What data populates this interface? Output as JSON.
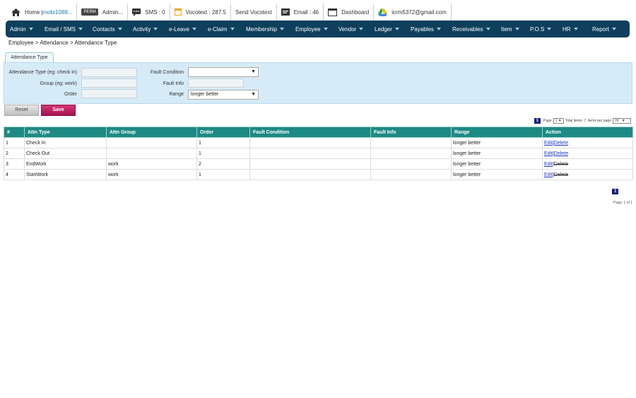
{
  "topbar": {
    "home_label": "Home | ",
    "home_user": "mobi1088...",
    "perm_badge": "PERM",
    "admin_label": "Admin...",
    "sms_label": "SMS : 0",
    "vocotext_label": "Vocotext : 287.5",
    "send_vocotext_label": "Send Vocotext",
    "email_label": "Email : 46",
    "dashboard_label": "Dashboard",
    "account_email": "icrm5372@gmail.com"
  },
  "nav": [
    "Admin",
    "Email / SMS",
    "Contacts",
    "Activity",
    "e-Leave",
    "e-Claim",
    "Membership",
    "Employee",
    "Vendor",
    "Ledger",
    "Payables",
    "Receivables",
    "Item",
    "P.O.S",
    "HR",
    "Report"
  ],
  "breadcrumb": "Employee > Attendance > Attendance Type",
  "tab_label": "Attendance Type",
  "form": {
    "attn_type_label": "Attendance Type (eg: check in)",
    "group_label": "Group (eg: work)",
    "order_label": "Order",
    "fault_condition_label": "Fault Condition",
    "fault_info_label": "Fault Info",
    "range_label": "Range",
    "range_value": "longer better",
    "fault_condition_value": "",
    "reset_label": "Reset",
    "save_label": "Save"
  },
  "pager": {
    "current_page": "1",
    "page_label": "Page",
    "page_select": "1",
    "total_items_text": "Total items: 7, items per page",
    "per_page": "20",
    "page_of_text": "Page: 1 of 1"
  },
  "table": {
    "headers": [
      "#",
      "Attn Type",
      "Attn Group",
      "Order",
      "Fault Condition",
      "Fault Info",
      "Range",
      "Action"
    ],
    "rows": [
      {
        "num": "1",
        "type": "Check In",
        "group": "",
        "order": "1",
        "fault_condition": "",
        "fault_info": "",
        "range": "longer better",
        "edit": "Edit",
        "delete": "Delete",
        "delete_enabled": true
      },
      {
        "num": "2",
        "type": "Check Out",
        "group": "",
        "order": "1",
        "fault_condition": "",
        "fault_info": "",
        "range": "longer better",
        "edit": "Edit",
        "delete": "Delete",
        "delete_enabled": true
      },
      {
        "num": "3",
        "type": "EndWork",
        "group": "work",
        "order": "2",
        "fault_condition": "",
        "fault_info": "",
        "range": "longer better",
        "edit": "Edit",
        "delete": "Delete",
        "delete_enabled": false
      },
      {
        "num": "4",
        "type": "StartWork",
        "group": "work",
        "order": "1",
        "fault_condition": "",
        "fault_info": "",
        "range": "longer better",
        "edit": "Edit",
        "delete": "Delete",
        "delete_enabled": false
      }
    ]
  },
  "colors": {
    "nav_bg": "#0e3f5c",
    "table_header_bg": "#1d8a84",
    "save_button": "#c0185f",
    "form_panel_bg": "#d6ebf8"
  }
}
